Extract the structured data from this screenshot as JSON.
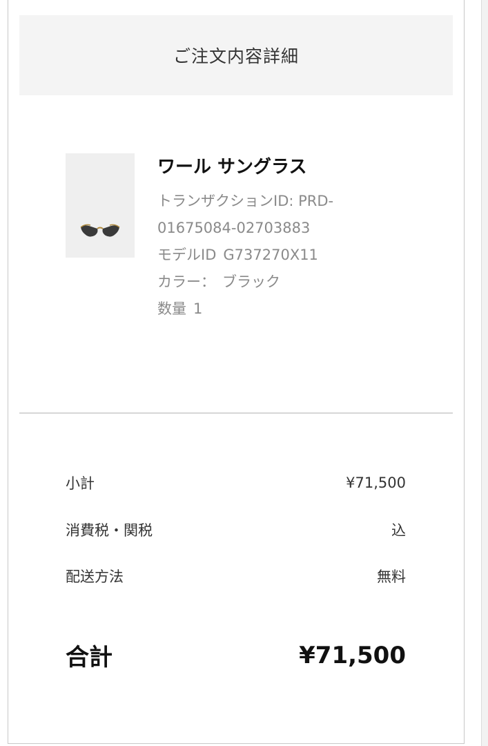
{
  "header": {
    "title": "ご注文内容詳細"
  },
  "product": {
    "image_icon": "sunglasses-thumbnail",
    "name": "ワール サングラス",
    "transaction_line1": "トランザクションID: PRD-",
    "transaction_line2": "01675084-02703883",
    "model_label": "モデルID",
    "model_value": "G737270X11",
    "color_label": "カラー：",
    "color_value": "ブラック",
    "quantity_label": "数量",
    "quantity_value": "1"
  },
  "summary": {
    "subtotal_label": "小計",
    "subtotal_value": "¥71,500",
    "tax_label": "消費税・関税",
    "tax_value": "込",
    "shipping_label": "配送方法",
    "shipping_value": "無料",
    "total_label": "合計",
    "total_value": "¥71,500"
  },
  "colors": {
    "header_bg": "#f4f4f4",
    "divider": "#d6d6d6",
    "muted_text": "#8a8a8a"
  }
}
